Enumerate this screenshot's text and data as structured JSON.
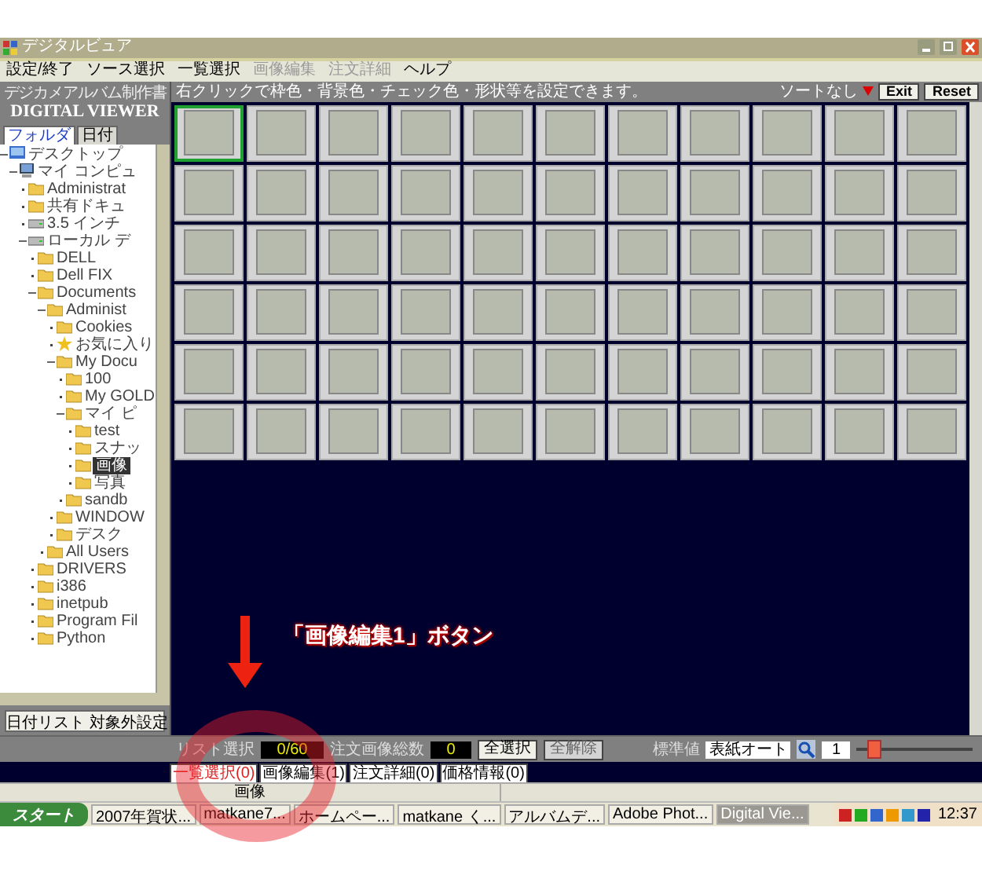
{
  "window": {
    "title": "デジタルビュア"
  },
  "menu": [
    {
      "label": "設定/終了",
      "disabled": false
    },
    {
      "label": "ソース選択",
      "disabled": false
    },
    {
      "label": "一覧選択",
      "disabled": false
    },
    {
      "label": "画像編集",
      "disabled": true
    },
    {
      "label": "注文詳細",
      "disabled": true
    },
    {
      "label": "ヘルプ",
      "disabled": false
    }
  ],
  "sidebar": {
    "subtitle": "デジカメアルバム制作書",
    "title": "DIGITAL VIEWER",
    "tabs": [
      {
        "label": "フォルダ",
        "selected": true
      },
      {
        "label": "日付",
        "selected": false
      }
    ],
    "tree": [
      {
        "label": "デスクトップ",
        "kind": "desktop",
        "selected": false,
        "children": [
          {
            "label": "マイ コンピュ",
            "kind": "computer",
            "selected": false,
            "children": [
              {
                "label": "Administrat",
                "kind": "folder",
                "selected": false
              },
              {
                "label": "共有ドキュ",
                "kind": "folder",
                "selected": false
              },
              {
                "label": "3.5 インチ",
                "kind": "drive",
                "selected": false
              },
              {
                "label": "ローカル デ",
                "kind": "drive",
                "selected": false,
                "children": [
                  {
                    "label": "DELL",
                    "kind": "folder",
                    "selected": false
                  },
                  {
                    "label": "Dell FIX",
                    "kind": "folder",
                    "selected": false
                  },
                  {
                    "label": "Documents",
                    "kind": "folder",
                    "selected": false,
                    "children": [
                      {
                        "label": "Administ",
                        "kind": "folder",
                        "selected": false,
                        "children": [
                          {
                            "label": "Cookies",
                            "kind": "folder",
                            "selected": false
                          },
                          {
                            "label": "お気に入り",
                            "kind": "star",
                            "selected": false
                          },
                          {
                            "label": "My Docu",
                            "kind": "folder",
                            "selected": false,
                            "children": [
                              {
                                "label": "100",
                                "kind": "folder",
                                "selected": false
                              },
                              {
                                "label": "My GOLD",
                                "kind": "folder",
                                "selected": false
                              },
                              {
                                "label": "マイ ピ",
                                "kind": "folder",
                                "selected": false,
                                "children": [
                                  {
                                    "label": "test",
                                    "kind": "folder",
                                    "selected": false
                                  },
                                  {
                                    "label": "スナッ",
                                    "kind": "folder",
                                    "selected": false
                                  },
                                  {
                                    "label": "画像",
                                    "kind": "folder",
                                    "selected": true
                                  },
                                  {
                                    "label": "写真",
                                    "kind": "folder",
                                    "selected": false
                                  }
                                ]
                              },
                              {
                                "label": "sandb",
                                "kind": "folder",
                                "selected": false
                              }
                            ]
                          },
                          {
                            "label": "WINDOW",
                            "kind": "folder",
                            "selected": false
                          },
                          {
                            "label": "デスク",
                            "kind": "folder",
                            "selected": false
                          }
                        ]
                      },
                      {
                        "label": "All Users",
                        "kind": "folder",
                        "selected": false
                      }
                    ]
                  },
                  {
                    "label": "DRIVERS",
                    "kind": "folder",
                    "selected": false
                  },
                  {
                    "label": "i386",
                    "kind": "folder",
                    "selected": false
                  },
                  {
                    "label": "inetpub",
                    "kind": "folder",
                    "selected": false
                  },
                  {
                    "label": "Program Fil",
                    "kind": "folder",
                    "selected": false
                  },
                  {
                    "label": "Python",
                    "kind": "folder",
                    "selected": false
                  }
                ]
              }
            ]
          }
        ]
      }
    ],
    "button": "日付リスト 対象外設定"
  },
  "toolbar": {
    "hint": "右クリックで枠色・背景色・チェック色・形状等を設定できます。",
    "sort": "ソートなし",
    "buttons": [
      "Exit",
      "Reset"
    ]
  },
  "thumbnails": [
    {
      "selected": true
    },
    {
      "selected": false
    },
    {
      "selected": false
    },
    {
      "selected": false
    },
    {
      "selected": false
    },
    {
      "selected": false
    },
    {
      "selected": false
    },
    {
      "selected": false
    },
    {
      "selected": false
    },
    {
      "selected": false
    },
    {
      "selected": false
    },
    {
      "selected": false
    },
    {
      "selected": false
    },
    {
      "selected": false
    },
    {
      "selected": false
    },
    {
      "selected": false
    },
    {
      "selected": false
    },
    {
      "selected": false
    },
    {
      "selected": false
    },
    {
      "selected": false
    },
    {
      "selected": false
    },
    {
      "selected": false
    },
    {
      "selected": false
    },
    {
      "selected": false
    },
    {
      "selected": false
    },
    {
      "selected": false
    },
    {
      "selected": false
    },
    {
      "selected": false
    },
    {
      "selected": false
    },
    {
      "selected": false
    },
    {
      "selected": false
    },
    {
      "selected": false
    },
    {
      "selected": false
    },
    {
      "selected": false
    },
    {
      "selected": false
    },
    {
      "selected": false
    },
    {
      "selected": false
    },
    {
      "selected": false
    },
    {
      "selected": false
    },
    {
      "selected": false
    },
    {
      "selected": false
    },
    {
      "selected": false
    },
    {
      "selected": false
    },
    {
      "selected": false
    },
    {
      "selected": false
    },
    {
      "selected": false
    },
    {
      "selected": false
    },
    {
      "selected": false
    },
    {
      "selected": false
    },
    {
      "selected": false
    },
    {
      "selected": false
    },
    {
      "selected": false
    },
    {
      "selected": false
    },
    {
      "selected": false
    },
    {
      "selected": false
    },
    {
      "selected": false
    },
    {
      "selected": false
    },
    {
      "selected": false
    },
    {
      "selected": false
    },
    {
      "selected": false
    },
    {
      "selected": false
    },
    {
      "selected": false
    },
    {
      "selected": false
    },
    {
      "selected": false
    },
    {
      "selected": false
    },
    {
      "selected": false
    }
  ],
  "bottom_bar": {
    "list_label": "リスト選択",
    "list_value": "0/60",
    "order_label": "注文画像総数",
    "order_value": "0",
    "buttons": [
      {
        "label": "全選択",
        "disabled": false
      },
      {
        "label": "全解除",
        "disabled": true
      }
    ],
    "standard_label": "標準値",
    "standard_select": "表紙オート",
    "spin_value": "1",
    "zoom": {
      "level": 0.1
    }
  },
  "tabs": [
    {
      "label": "一覧選択(0)",
      "selected": true
    },
    {
      "label": "画像編集(1)",
      "selected": false
    },
    {
      "label": "注文詳細(0)",
      "selected": false
    },
    {
      "label": "価格情報(0)",
      "selected": false
    }
  ],
  "status_bar": {
    "label": "画像"
  },
  "taskbar": {
    "start": "スタート",
    "items": [
      {
        "label": "2007年賀状...",
        "active": false
      },
      {
        "label": "matkane7...",
        "active": false
      },
      {
        "label": "ホームペー...",
        "active": false
      },
      {
        "label": "matkane く...",
        "active": false
      },
      {
        "label": "アルバムデ...",
        "active": false
      },
      {
        "label": "Adobe Phot...",
        "active": false
      },
      {
        "label": "Digital Vie...",
        "active": true
      }
    ],
    "clock": "12:37"
  },
  "annotation": {
    "text": "「画像編集1」ボタン"
  }
}
